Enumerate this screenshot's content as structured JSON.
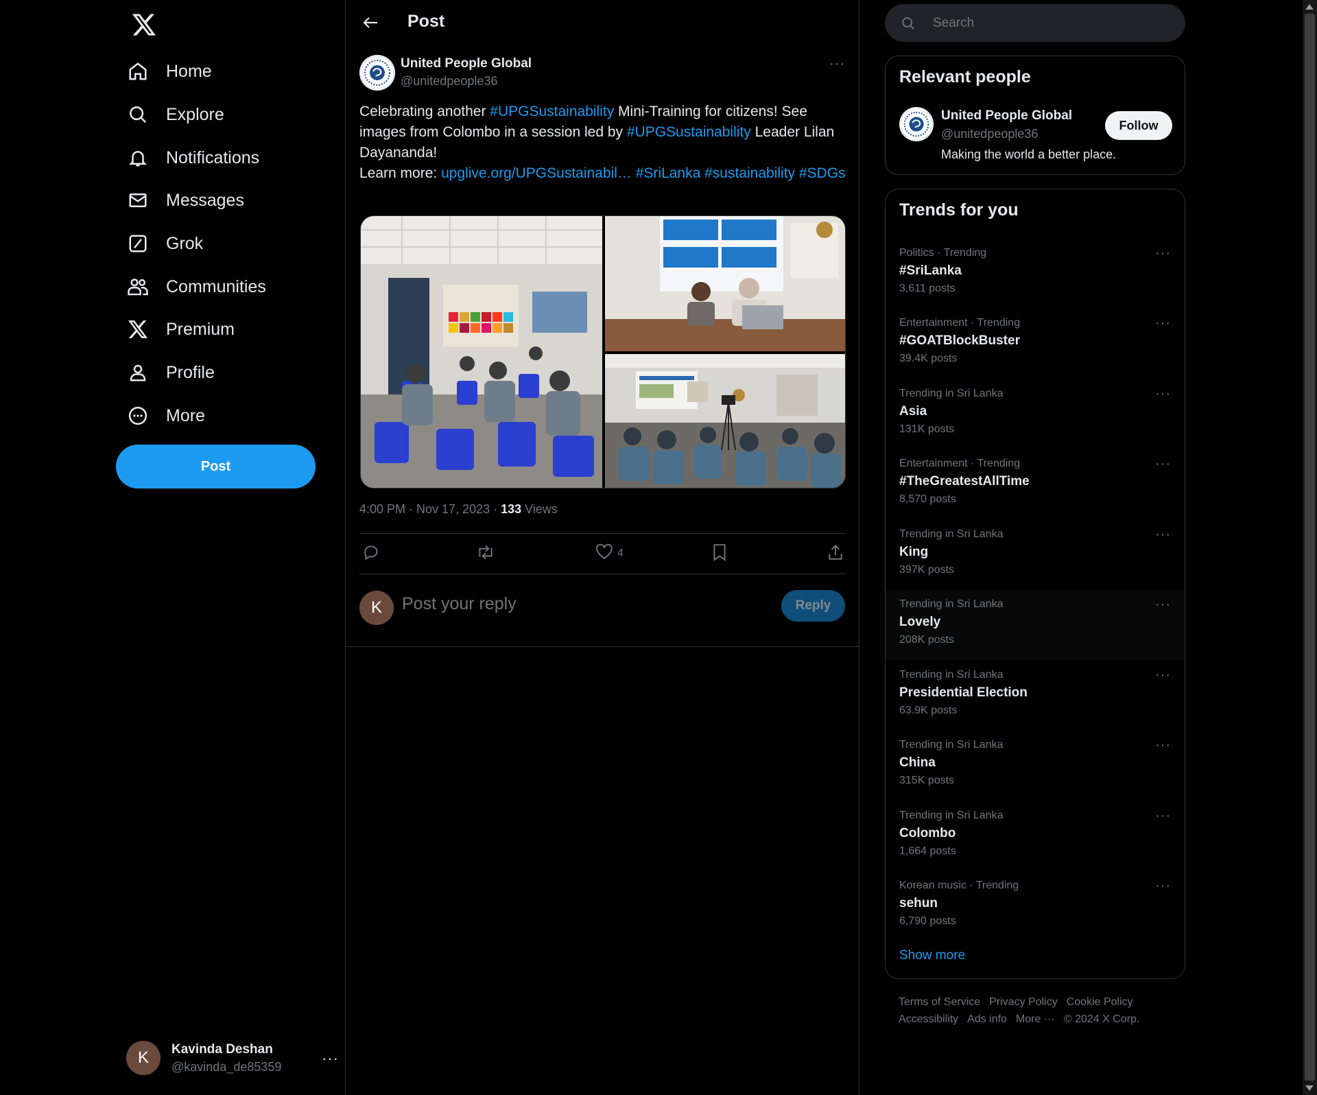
{
  "nav": {
    "items": [
      {
        "label": "Home",
        "icon": "home-icon"
      },
      {
        "label": "Explore",
        "icon": "search-icon"
      },
      {
        "label": "Notifications",
        "icon": "bell-icon"
      },
      {
        "label": "Messages",
        "icon": "envelope-icon"
      },
      {
        "label": "Grok",
        "icon": "grok-icon"
      },
      {
        "label": "Communities",
        "icon": "communities-icon"
      },
      {
        "label": "Premium",
        "icon": "x-logo-icon"
      },
      {
        "label": "Profile",
        "icon": "person-icon"
      },
      {
        "label": "More",
        "icon": "more-circle-icon"
      }
    ],
    "post_label": "Post"
  },
  "account": {
    "initial": "K",
    "name": "Kavinda Deshan",
    "handle": "@kavinda_de85359",
    "more": "···"
  },
  "header": {
    "title": "Post"
  },
  "tweet": {
    "author_name": "United People Global",
    "author_handle": "@unitedpeople36",
    "more": "···",
    "text": {
      "t1": "Celebrating another ",
      "l1": "#UPGSustainability",
      "t2": " Mini-Training for citizens! See images from Colombo in a session led by ",
      "l2": "#UPGSustainability",
      "t3": " Leader Lilan Dayananda!",
      "t4": "Learn more: ",
      "l3": "upglive.org/UPGSustainabil…",
      "l4": "#SriLanka",
      "l5": "#sustainability",
      "l6": "#SDGs"
    },
    "time": "4:00 PM · Nov 17, 2023 · ",
    "views_count": "133",
    "views_label": " Views",
    "likes": "4"
  },
  "reply": {
    "initial": "K",
    "placeholder": "Post your reply",
    "button": "Reply"
  },
  "search": {
    "placeholder": "Search"
  },
  "relevant": {
    "title": "Relevant people",
    "name": "United People Global",
    "handle": "@unitedpeople36",
    "bio": "Making the world a better place.",
    "follow": "Follow"
  },
  "trends": {
    "title": "Trends for you",
    "items": [
      {
        "context": "Politics · Trending",
        "name": "#SriLanka",
        "count": "3,611 posts"
      },
      {
        "context": "Entertainment · Trending",
        "name": "#GOATBlockBuster",
        "count": "39.4K posts"
      },
      {
        "context": "Trending in Sri Lanka",
        "name": "Asia",
        "count": "131K posts"
      },
      {
        "context": "Entertainment · Trending",
        "name": "#TheGreatestAllTime",
        "count": "8,570 posts"
      },
      {
        "context": "Trending in Sri Lanka",
        "name": "King",
        "count": "397K posts"
      },
      {
        "context": "Trending in Sri Lanka",
        "name": "Lovely",
        "count": "208K posts"
      },
      {
        "context": "Trending in Sri Lanka",
        "name": "Presidential Election",
        "count": "63.9K posts"
      },
      {
        "context": "Trending in Sri Lanka",
        "name": "China",
        "count": "315K posts"
      },
      {
        "context": "Trending in Sri Lanka",
        "name": "Colombo",
        "count": "1,664 posts"
      },
      {
        "context": "Korean music · Trending",
        "name": "sehun",
        "count": "6,790 posts"
      }
    ],
    "dots": "···",
    "show_more": "Show more"
  },
  "footer": {
    "links": [
      "Terms of Service",
      "Privacy Policy",
      "Cookie Policy",
      "Accessibility",
      "Ads info",
      "More ···",
      "© 2024 X Corp."
    ]
  },
  "colors": {
    "accent": "#1d9bf0",
    "background": "#000000",
    "border": "#2f3336",
    "muted": "#71767b"
  }
}
